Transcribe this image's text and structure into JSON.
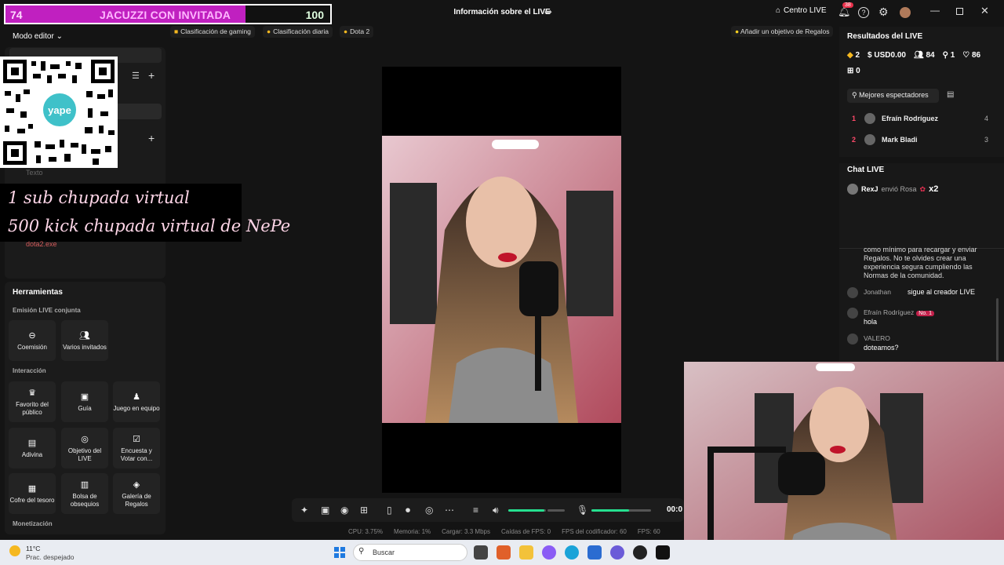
{
  "goal_bar": {
    "left_value": "74",
    "title": "JACUZZI CON INVITADA",
    "right_value": "100",
    "progress": 0.74
  },
  "titlebar": {
    "title": "Información sobre el LIVE",
    "centro_live": "Centro LIVE",
    "notification_count": "38"
  },
  "editor": {
    "mode_label": "Modo editor",
    "texto_label": "Texto",
    "source_name": "dota2.exe"
  },
  "overlay_text": {
    "line1": "1 sub chupada virtual",
    "line2": "500 kick chupada virtual de NePe",
    "qr_brand": "yape"
  },
  "chips": [
    "Clasificación de gaming",
    "Clasificación diaria",
    "Dota 2"
  ],
  "goal_chip": "Añadir un objetivo de Regalos",
  "tools": {
    "title": "Herramientas",
    "section1": "Emisión LIVE conjunta",
    "section2": "Interacción",
    "section3": "Monetización",
    "items": [
      {
        "icon": "link-icon",
        "label": "Coemisión"
      },
      {
        "icon": "people-icon",
        "label": "Varios invitados"
      },
      {
        "icon": "favorite-icon",
        "label": "Favorito del público"
      },
      {
        "icon": "book-icon",
        "label": "Guía"
      },
      {
        "icon": "team-icon",
        "label": "Juego en equipo"
      },
      {
        "icon": "guess-icon",
        "label": "Adivina"
      },
      {
        "icon": "target-icon",
        "label": "Objetivo del LIVE"
      },
      {
        "icon": "poll-icon",
        "label": "Encuesta y Votar con..."
      },
      {
        "icon": "chest-icon",
        "label": "Cofre del tesoro"
      },
      {
        "icon": "bag-icon",
        "label": "Bolsa de obsequios"
      },
      {
        "icon": "gallery-icon",
        "label": "Galería de Regalos"
      }
    ]
  },
  "controls": {
    "timer": "00:0"
  },
  "stats": {
    "cpu": "CPU: 3.75%",
    "memory": "Memoria: 1%",
    "upload": "Cargar: 3.3 Mbps",
    "fps_drops": "Caídas de FPS: 0",
    "encoder_fps": "FPS del codificador: 60",
    "fps": "FPS: 60"
  },
  "results": {
    "title": "Resultados del LIVE",
    "diamonds": "2",
    "usd": "USD0.00",
    "viewers": "84",
    "followers": "1",
    "likes": "86",
    "gifts": "0",
    "best_viewers_label": "Mejores espectadores",
    "top_viewers": [
      {
        "rank": "1",
        "name": "Efraín Rodríguez",
        "score": "4"
      },
      {
        "rank": "2",
        "name": "Mark Bladi",
        "score": "3"
      }
    ]
  },
  "chat": {
    "title": "Chat LIVE",
    "gift_user": "RexJ",
    "gift_text": "envió Rosa",
    "gift_multiplier": "x2",
    "notice": "como mínimo para recargar y enviar Regalos. No te olvides crear una experiencia segura cumpliendo las Normas de la comunidad.",
    "messages": [
      {
        "user": "Jonathan",
        "text": "sigue al creador LIVE",
        "inline": true
      },
      {
        "user": "Efraín Rodríguez",
        "badge": "No. 1",
        "text": "hola"
      },
      {
        "user": "VALERO",
        "text": "doteamos?"
      }
    ]
  },
  "taskbar": {
    "temp": "11°C",
    "weather": "Prac. despejado",
    "search_placeholder": "Buscar"
  },
  "colors": {
    "accent_green": "#25e08f",
    "goal_magenta": "#c020c0",
    "rank_red": "#ff4a6a"
  }
}
